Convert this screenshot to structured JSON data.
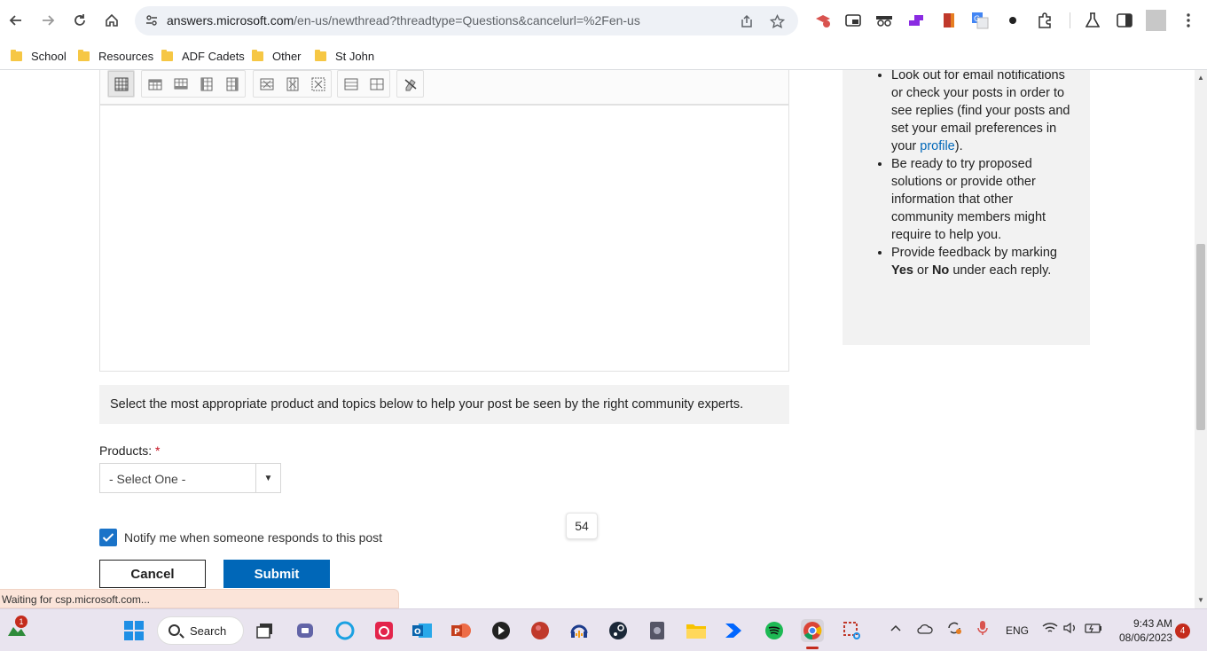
{
  "browser": {
    "url_host": "answers.microsoft.com",
    "url_path": "/en-us/newthread?threadtype=Questions&cancelurl=%2Fen-us",
    "bookmarks": [
      "School",
      "Resources",
      "ADF Cadets",
      "Other",
      "St John"
    ]
  },
  "side_panel": {
    "items": [
      {
        "text_before": "Look out for email notifications or check your posts in order to see replies (find your posts and set your email preferences in your ",
        "link": "profile",
        "text_after": ")."
      },
      {
        "text": "Be ready to try proposed solutions or provide other information that other community members might require to help you."
      },
      {
        "text_before": "Provide feedback by marking ",
        "bold1": "Yes",
        "mid": " or ",
        "bold2": "No",
        "text_after": " under each reply."
      }
    ]
  },
  "form": {
    "info_text": "Select the most appropriate product and topics below to help your post be seen by the right community experts.",
    "products_label": "Products:",
    "required_mark": "*",
    "products_value": "- Select One -",
    "notify_label": "Notify me when someone responds to this post",
    "notify_checked": true,
    "cancel_label": "Cancel",
    "submit_label": "Submit",
    "count_badge": "54"
  },
  "status_bar": "Waiting for csp.microsoft.com...",
  "taskbar": {
    "search_label": "Search",
    "widget_badge": "1",
    "language": "ENG",
    "time": "9:43 AM",
    "date": "08/06/2023",
    "notification_count": "4"
  },
  "colors": {
    "accent": "#0067b8",
    "checkbox": "#1a73c8",
    "status_bg": "#fbe4d9"
  }
}
